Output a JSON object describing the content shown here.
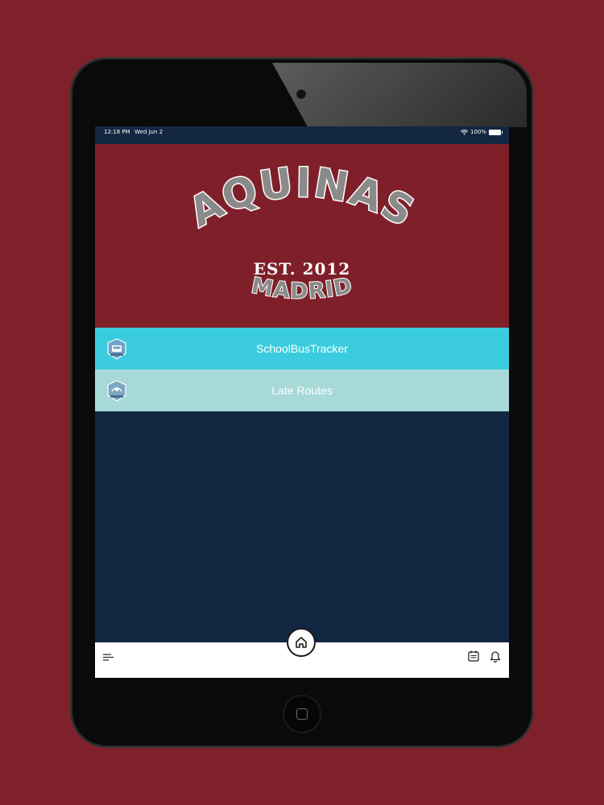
{
  "status_bar": {
    "time": "12:18 PM",
    "date": "Wed Jun 2",
    "battery": "100%"
  },
  "hero": {
    "school": "AQUINAS",
    "established": "EST. 2012",
    "city": "MADRID"
  },
  "menu": [
    {
      "label": "SchoolBusTracker",
      "icon": "bus-badge-icon",
      "color": "#3accde"
    },
    {
      "label": "Late Routes",
      "icon": "route-badge-icon",
      "color": "#a6d9d8"
    }
  ],
  "bottom_bar": {
    "left_icon": "menu-lines-icon",
    "center_icon": "home-icon",
    "right_icons": [
      "calendar-icon",
      "bell-icon"
    ]
  },
  "colors": {
    "background": "#7e212b",
    "hero": "#7f1f2a",
    "screen": "#132742",
    "accent": "#3accde"
  }
}
